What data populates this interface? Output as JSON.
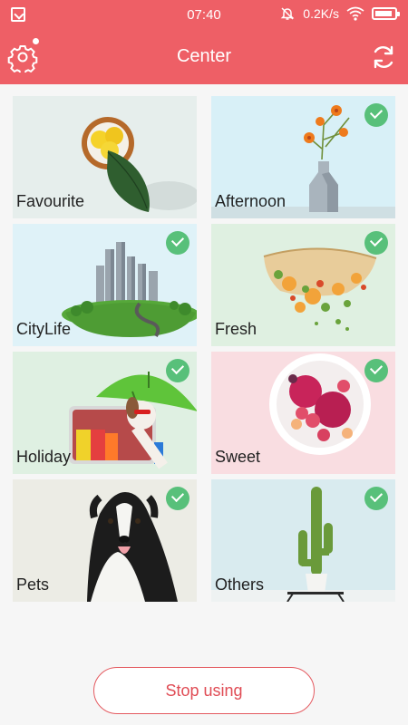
{
  "status_bar": {
    "time": "07:40",
    "network_speed": "0.2K/s",
    "icons": [
      "notification-app-icon",
      "mute-icon",
      "wifi-icon",
      "battery-icon"
    ]
  },
  "header": {
    "title": "Center",
    "left_icon": "gear-icon",
    "right_icon": "refresh-icon",
    "background_color": "#ee5f66"
  },
  "categories": [
    {
      "label": "Favourite",
      "selected": false,
      "background": "#e6eeec"
    },
    {
      "label": "Afternoon",
      "selected": true,
      "background": "#d8f0f7"
    },
    {
      "label": "CityLife",
      "selected": true,
      "background": "#dff2f8"
    },
    {
      "label": "Fresh",
      "selected": true,
      "background": "#dff0e1"
    },
    {
      "label": "Holiday",
      "selected": true,
      "background": "#dff0e2"
    },
    {
      "label": "Sweet",
      "selected": true,
      "background": "#f9dde1"
    },
    {
      "label": "Pets",
      "selected": true,
      "background": "#ecece5"
    },
    {
      "label": "Others",
      "selected": true,
      "background": "#d9ebef"
    }
  ],
  "footer": {
    "stop_label": "Stop using",
    "accent_color": "#e45a60"
  }
}
